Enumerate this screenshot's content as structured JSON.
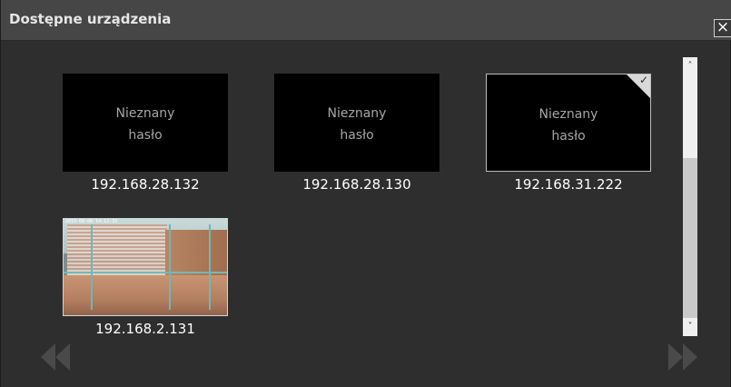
{
  "dialog": {
    "title": "Dostępne urządzenia",
    "close_label": "×"
  },
  "devices": [
    {
      "ip": "192.168.28.132",
      "line1": "Nieznany",
      "line2": "hasło",
      "selected": false
    },
    {
      "ip": "192.168.28.130",
      "line1": "Nieznany",
      "line2": "hasło",
      "selected": false
    },
    {
      "ip": "192.168.31.222",
      "line1": "Nieznany",
      "line2": "hasło",
      "selected": true,
      "check": "✓"
    },
    {
      "ip": "192.168.2.131",
      "preview": "camera-feed",
      "osd_text": "2019-08-06 14:12:33"
    }
  ],
  "scrollbar": {
    "up_icon": "chevron-up-icon",
    "down_icon": "chevron-down-icon",
    "up_glyph": "˄",
    "down_glyph": "˅"
  },
  "navigation": {
    "prev_icon": "double-arrow-left-icon",
    "next_icon": "double-arrow-right-icon"
  },
  "colors": {
    "background": "#2e2e2e",
    "titlebar": "#464646",
    "thumb": "#000000",
    "label": "#ffffff",
    "nav_arrow": "#4a4a4a"
  }
}
